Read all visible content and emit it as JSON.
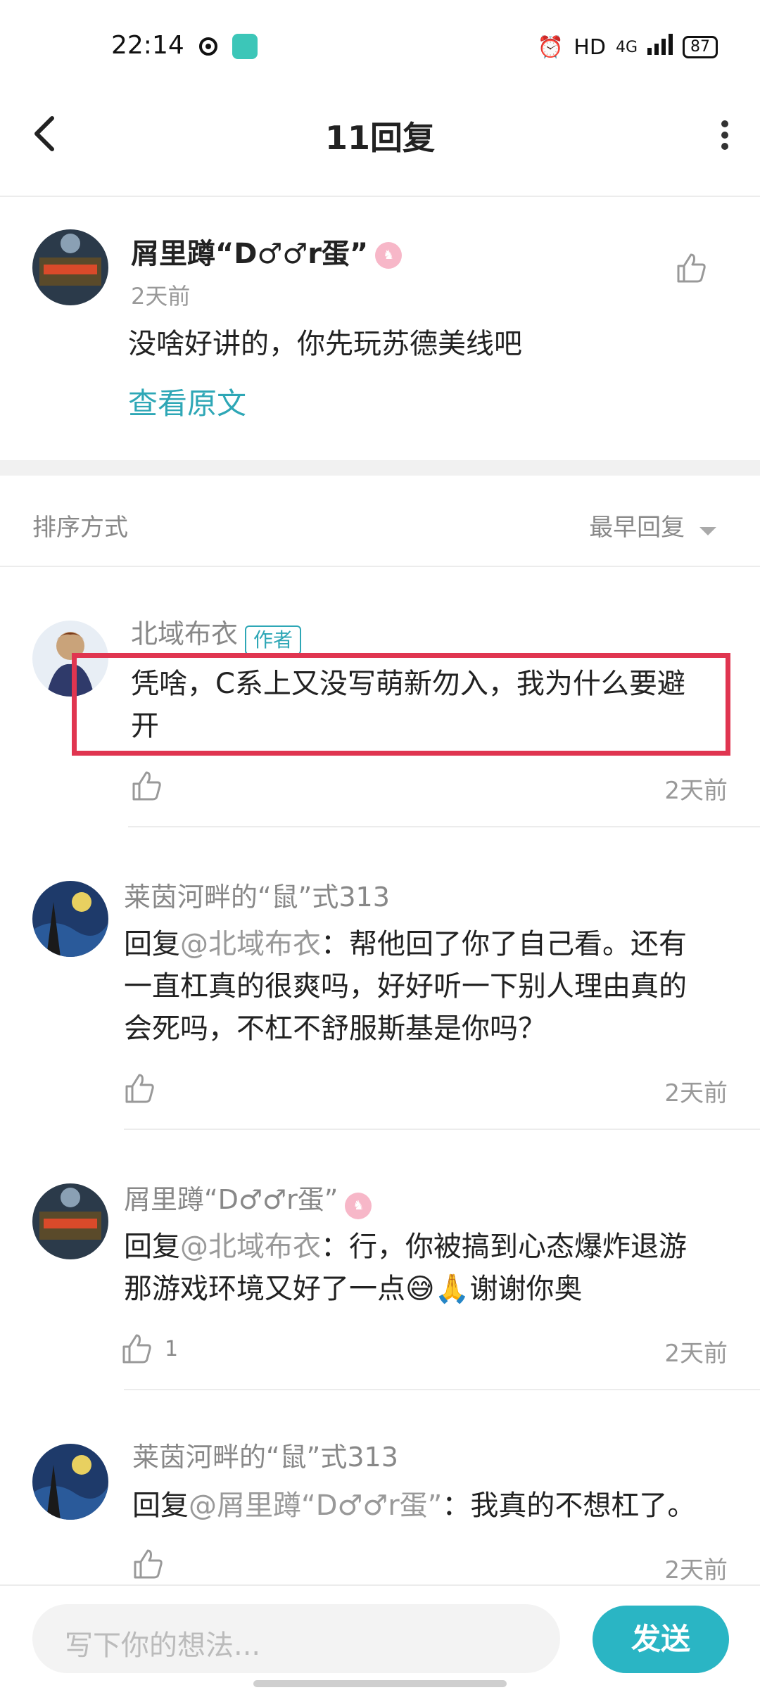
{
  "status": {
    "time": "22:14",
    "network": "HD",
    "signal": "4G",
    "battery": "87"
  },
  "header": {
    "title": "11回复"
  },
  "original": {
    "author": "屑里蹲“D♂♂r蛋”",
    "time": "2天前",
    "text": "没啥好讲的，你先玩苏德美线吧",
    "view_original": "查看原文"
  },
  "sort": {
    "label": "排序方式",
    "value": "最早回复"
  },
  "replies": [
    {
      "author": "北域布衣",
      "tag": "作者",
      "text": "凭啥，C系上又没写萌新勿入，我为什么要避",
      "text2": "开",
      "time": "2天前"
    },
    {
      "author": "莱茵河畔的“鼠”式313",
      "prefix": "回复",
      "mention": "@北域布衣",
      "line1": "：帮他回了你了自己看。还有",
      "line2": "一直杠真的很爽吗，好好听一下别人理由真的",
      "line3": "会死吗，不杠不舒服斯基是你吗？",
      "time": "2天前"
    },
    {
      "author": "屑里蹲“D♂♂r蛋”",
      "prefix": "回复",
      "mention": "@北域布衣",
      "line1": "：行，你被搞到心态爆炸退游",
      "line2": "那游戏环境又好了一点😅🙏谢谢你奥",
      "likes": "1",
      "time": "2天前"
    },
    {
      "author": "莱茵河畔的“鼠”式313",
      "prefix": "回复",
      "mention": "@屑里蹲“D♂♂r蛋”",
      "line1": "：我真的不想杠了。",
      "time": "2天前"
    }
  ],
  "input": {
    "placeholder": "写下你的想法...",
    "send": "发送"
  }
}
